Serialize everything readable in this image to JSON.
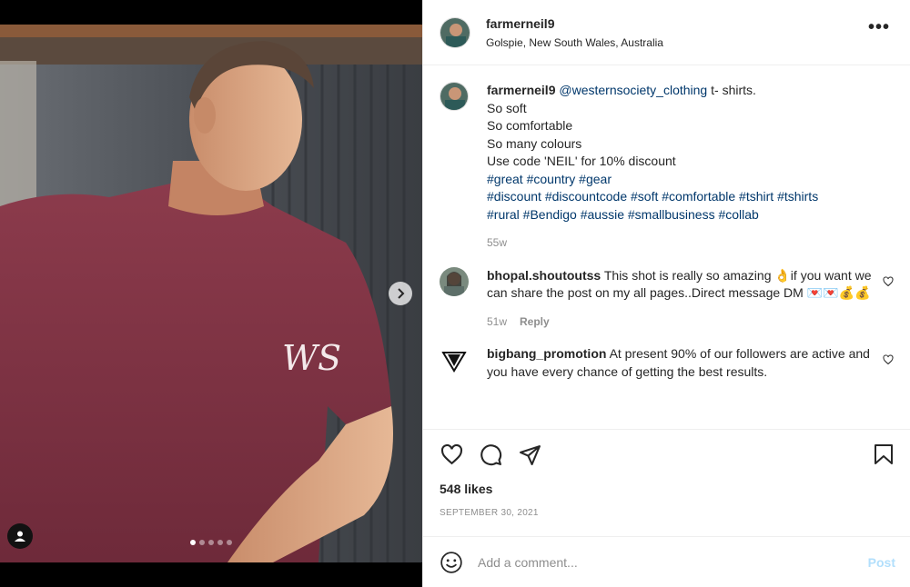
{
  "post": {
    "username": "farmerneil9",
    "location": "Golspie, New South Wales, Australia",
    "more_label": "•••",
    "caption": {
      "username": "farmerneil9",
      "mention": "@westernsociety_clothing",
      "lead": " t- shirts.",
      "lines": [
        "So soft",
        "So comfortable",
        "So many colours",
        "Use code 'NEIL' for 10% discount"
      ],
      "hashtags_line1": "#great #country #gear",
      "hashtags_line2": "#discount #discountcode #soft #comfortable #tshirt #tshirts",
      "hashtags_line3": "#rural #Bendigo #aussie #smallbusiness #collab",
      "age": "55w"
    },
    "comments": [
      {
        "username": "bhopal.shoutoutss",
        "text": "This shot is really so amazing 👌if you want we can share the post on my all pages..Direct message DM 💌💌💰💰",
        "age": "51w",
        "reply_label": "Reply"
      },
      {
        "username": "bigbang_promotion",
        "text": "At present 90% of our followers are active and you have every chance of getting the best results."
      }
    ],
    "likes": "548 likes",
    "date": "September 30, 2021",
    "comment_placeholder": "Add a comment...",
    "post_label": "Post",
    "carousel": {
      "count": 5,
      "active_index": 0
    },
    "shirt_logo": "WS"
  }
}
